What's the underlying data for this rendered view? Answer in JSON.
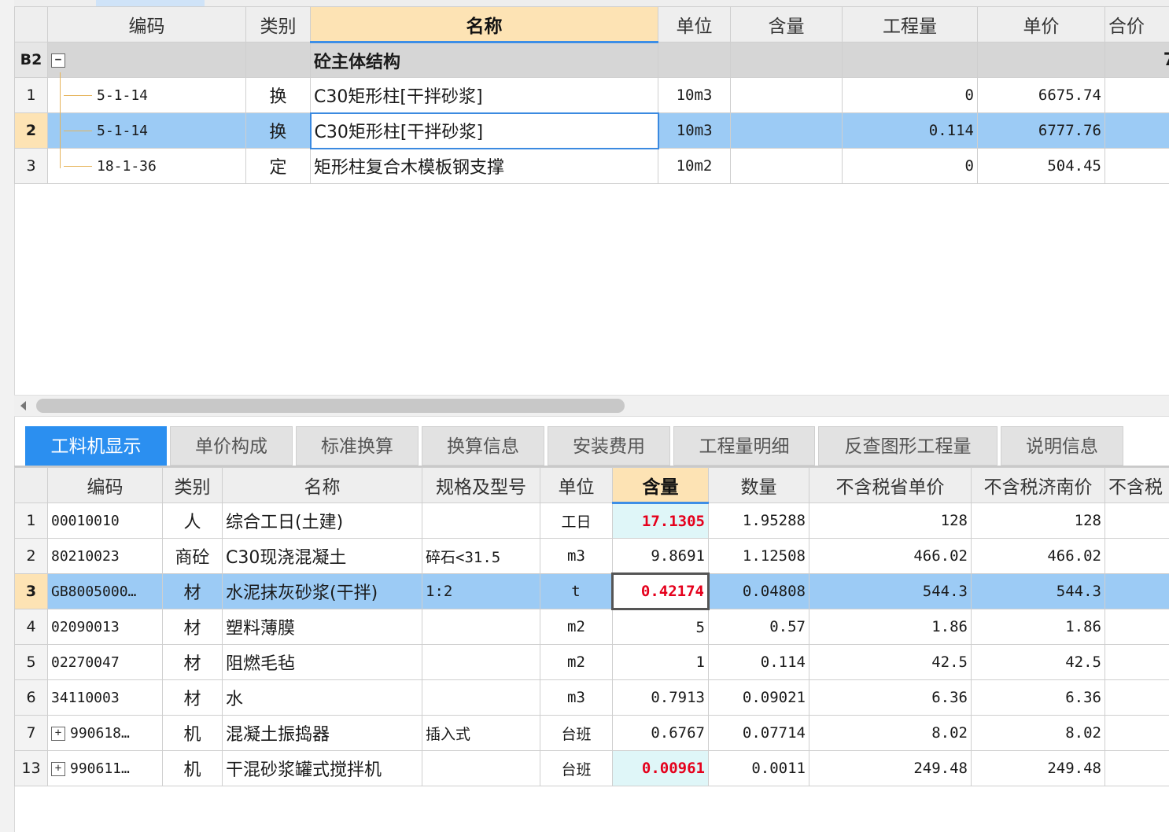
{
  "upper": {
    "headers": [
      "编码",
      "类别",
      "名称",
      "单位",
      "含量",
      "工程量",
      "单价",
      "合价"
    ],
    "group": {
      "label": "B2",
      "expander": "−",
      "name": "砼主体结构",
      "partial": "7"
    },
    "rows": [
      {
        "rn": "1",
        "code": "5-1-14",
        "type": "换",
        "name": "C30矩形柱[干拌砂浆]",
        "unit": "10m3",
        "content": "",
        "qty": "0",
        "price": "6675.74"
      },
      {
        "rn": "2",
        "code": "5-1-14",
        "type": "换",
        "name": "C30矩形柱[干拌砂浆]",
        "unit": "10m3",
        "content": "",
        "qty": "0.114",
        "price": "6777.76"
      },
      {
        "rn": "3",
        "code": "18-1-36",
        "type": "定",
        "name": "矩形柱复合木模板钢支撑",
        "unit": "10m2",
        "content": "",
        "qty": "0",
        "price": "504.45"
      }
    ]
  },
  "tabs": [
    "工料机显示",
    "单价构成",
    "标准换算",
    "换算信息",
    "安装费用",
    "工程量明细",
    "反查图形工程量",
    "说明信息"
  ],
  "lower": {
    "headers": [
      "编码",
      "类别",
      "名称",
      "规格及型号",
      "单位",
      "含量",
      "数量",
      "不含税省单价",
      "不含税济南价",
      "不含税"
    ],
    "rows": [
      {
        "rn": "1",
        "expander": "",
        "code": "00010010",
        "type": "人",
        "name": "综合工日(土建)",
        "spec": "",
        "unit": "工日",
        "content": "17.1305",
        "amount": "1.95288",
        "prov": "128",
        "jinan": "128"
      },
      {
        "rn": "2",
        "expander": "",
        "code": "80210023",
        "type": "商砼",
        "name": "C30现浇混凝土",
        "spec": "碎石<31.5",
        "unit": "m3",
        "content": "9.8691",
        "amount": "1.12508",
        "prov": "466.02",
        "jinan": "466.02"
      },
      {
        "rn": "3",
        "expander": "",
        "code": "GB8005000…",
        "type": "材",
        "name": "水泥抹灰砂浆(干拌)",
        "spec": "1:2",
        "unit": "t",
        "content": "0.42174",
        "amount": "0.04808",
        "prov": "544.3",
        "jinan": "544.3"
      },
      {
        "rn": "4",
        "expander": "",
        "code": "02090013",
        "type": "材",
        "name": "塑料薄膜",
        "spec": "",
        "unit": "m2",
        "content": "5",
        "amount": "0.57",
        "prov": "1.86",
        "jinan": "1.86"
      },
      {
        "rn": "5",
        "expander": "",
        "code": "02270047",
        "type": "材",
        "name": "阻燃毛毡",
        "spec": "",
        "unit": "m2",
        "content": "1",
        "amount": "0.114",
        "prov": "42.5",
        "jinan": "42.5"
      },
      {
        "rn": "6",
        "expander": "",
        "code": "34110003",
        "type": "材",
        "name": "水",
        "spec": "",
        "unit": "m3",
        "content": "0.7913",
        "amount": "0.09021",
        "prov": "6.36",
        "jinan": "6.36"
      },
      {
        "rn": "7",
        "expander": "+",
        "code": "990618…",
        "type": "机",
        "name": "混凝土振捣器",
        "spec": "插入式",
        "unit": "台班",
        "content": "0.6767",
        "amount": "0.07714",
        "prov": "8.02",
        "jinan": "8.02"
      },
      {
        "rn": "13",
        "expander": "+",
        "code": "990611…",
        "type": "机",
        "name": "干混砂浆罐式搅拌机",
        "spec": "",
        "unit": "台班",
        "content": "0.00961",
        "amount": "0.0011",
        "prov": "249.48",
        "jinan": "249.48"
      }
    ]
  }
}
